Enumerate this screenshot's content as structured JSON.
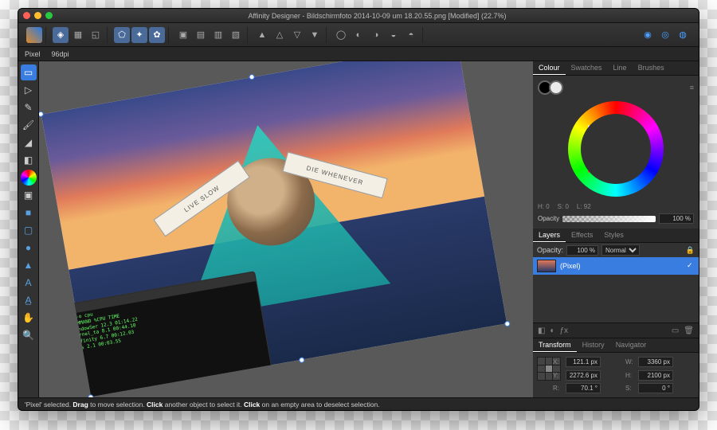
{
  "window": {
    "title": "Affinity Designer - Bildschirmfoto 2014-10-09 um 18.20.55.png [Modified] (22.7%)"
  },
  "context": {
    "unit": "Pixel",
    "dpi": "96dpi"
  },
  "artwork": {
    "banner_left": "LIVE SLOW",
    "banner_right": "DIE WHENEVER"
  },
  "colour_panel": {
    "tabs": [
      "Colour",
      "Swatches",
      "Line",
      "Brushes"
    ],
    "active_tab": 0,
    "h": "H: 0",
    "s": "S: 0",
    "l": "L: 92",
    "opacity_label": "Opacity",
    "opacity_value": "100 %"
  },
  "layers_panel": {
    "tabs": [
      "Layers",
      "Effects",
      "Styles"
    ],
    "active_tab": 0,
    "opacity_label": "Opacity:",
    "opacity_value": "100 %",
    "blend_mode": "Normal",
    "items": [
      {
        "name": "(Pixel)",
        "visible": true,
        "selected": true
      }
    ]
  },
  "transform_panel": {
    "tabs": [
      "Transform",
      "History",
      "Navigator"
    ],
    "active_tab": 0,
    "x_label": "X:",
    "x": "121.1 px",
    "y_label": "Y:",
    "y": "2272.6 px",
    "w_label": "W:",
    "w": "3360 px",
    "h_label": "H:",
    "h": "2100 px",
    "r_label": "R:",
    "r": "70.1 °",
    "s_label": "S:",
    "s": "0 °"
  },
  "status": {
    "html": "'Pixel' selected. Drag to move selection. Click another object to select it. Click on an empty area to deselect selection."
  },
  "tools": [
    "move",
    "node",
    "pen",
    "brush",
    "fill",
    "gradient",
    "colour",
    "crop",
    "text",
    "shape-rect",
    "shape-round",
    "shape-ellipse",
    "shape-tri",
    "vector",
    "hand",
    "zoom"
  ],
  "toolbar": {
    "personas": [
      "draw-persona",
      "pixel-persona",
      "export-persona"
    ],
    "align": [
      "align-left",
      "align-center",
      "align-right",
      "align-top",
      "align-middle",
      "align-bottom"
    ],
    "arrange": [
      "front",
      "forward",
      "backward",
      "back"
    ],
    "bool": [
      "add",
      "subtract",
      "intersect",
      "xor",
      "divide"
    ],
    "right": [
      "snap",
      "preview",
      "assistant"
    ]
  }
}
